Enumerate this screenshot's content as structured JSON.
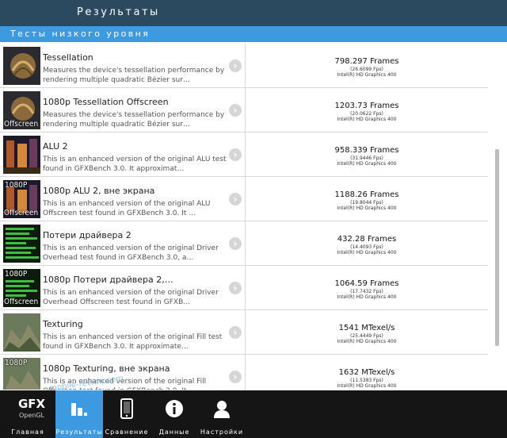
{
  "header": {
    "title": "Результаты"
  },
  "section": {
    "label": "Тесты низкого уровня"
  },
  "tests": [
    {
      "name": "Tessellation",
      "description": "Measures the device's tessellation performance by rendering multiple quadratic Bézier sur…",
      "score": "798.297 Frames",
      "fps": "(26.6099 Fps)",
      "gpu": "Intel(R) HD Graphics 400",
      "thumb_top": "",
      "thumb_bottom": ""
    },
    {
      "name": "1080p Tessellation Offscreen",
      "description": "Measures the device's tessellation performance by rendering multiple quadratic Bézier sur…",
      "score": "1203.73 Frames",
      "fps": "(20.0622 Fps)",
      "gpu": "Intel(R) HD Graphics 400",
      "thumb_top": "",
      "thumb_bottom": "Offscreen"
    },
    {
      "name": "ALU 2",
      "description": "This is an enhanced version of the original ALU test found in GFXBench 3.0. It approximat…",
      "score": "958.339 Frames",
      "fps": "(31.9446 Fps)",
      "gpu": "Intel(R) HD Graphics 400",
      "thumb_top": "",
      "thumb_bottom": ""
    },
    {
      "name": "1080p ALU 2, вне экрана",
      "description": "This is an enhanced version of the original ALU Offscreen test found in GFXBench 3.0. It …",
      "score": "1188.26 Frames",
      "fps": "(19.8044 Fps)",
      "gpu": "Intel(R) HD Graphics 400",
      "thumb_top": "1080P",
      "thumb_bottom": "Offscreen"
    },
    {
      "name": "Потери драйвера 2",
      "description": "This is an enhanced version of the original Driver Overhead test found in GFXBench 3.0, a…",
      "score": "432.28 Frames",
      "fps": "(14.4093 Fps)",
      "gpu": "Intel(R) HD Graphics 400",
      "thumb_top": "",
      "thumb_bottom": ""
    },
    {
      "name": "1080p Потери драйвера 2,…",
      "description": "This is an enhanced version of the original Driver Overhead Offscreen test found in GFXB…",
      "score": "1064.59 Frames",
      "fps": "(17.7432 Fps)",
      "gpu": "Intel(R) HD Graphics 400",
      "thumb_top": "1080P",
      "thumb_bottom": "Offscreen"
    },
    {
      "name": "Texturing",
      "description": "This is an enhanced version of the original Fill test found in GFXBench 3.0. It approximate…",
      "score": "1541 MTexel/s",
      "fps": "(25.4449 Fps)",
      "gpu": "Intel(R) HD Graphics 400",
      "thumb_top": "",
      "thumb_bottom": ""
    },
    {
      "name": "1080p Texturing, вне экрана",
      "description": "This is an enhanced version of the original Fill Offscreen test found in GFXBench 3.0. It …",
      "score": "1632 MTexel/s",
      "fps": "(11.5383 Fps)",
      "gpu": "Intel(R) HD Graphics 400",
      "thumb_top": "1080P",
      "thumb_bottom": ""
    }
  ],
  "nav": {
    "logo_text": "GFX",
    "logo_sub": "OpenGL",
    "items": [
      {
        "label": "Главная",
        "icon": "gfx-logo"
      },
      {
        "label": "Результаты",
        "icon": "bar-chart-icon"
      },
      {
        "label": "Сравнение",
        "icon": "phone-icon"
      },
      {
        "label": "Данные",
        "icon": "info-icon"
      },
      {
        "label": "Настройки",
        "icon": "user-icon"
      }
    ]
  },
  "watermark": "mobile-review.com",
  "colors": {
    "header": "#2b4a60",
    "accent": "#3d9ae0",
    "nav_bg": "#151515"
  }
}
